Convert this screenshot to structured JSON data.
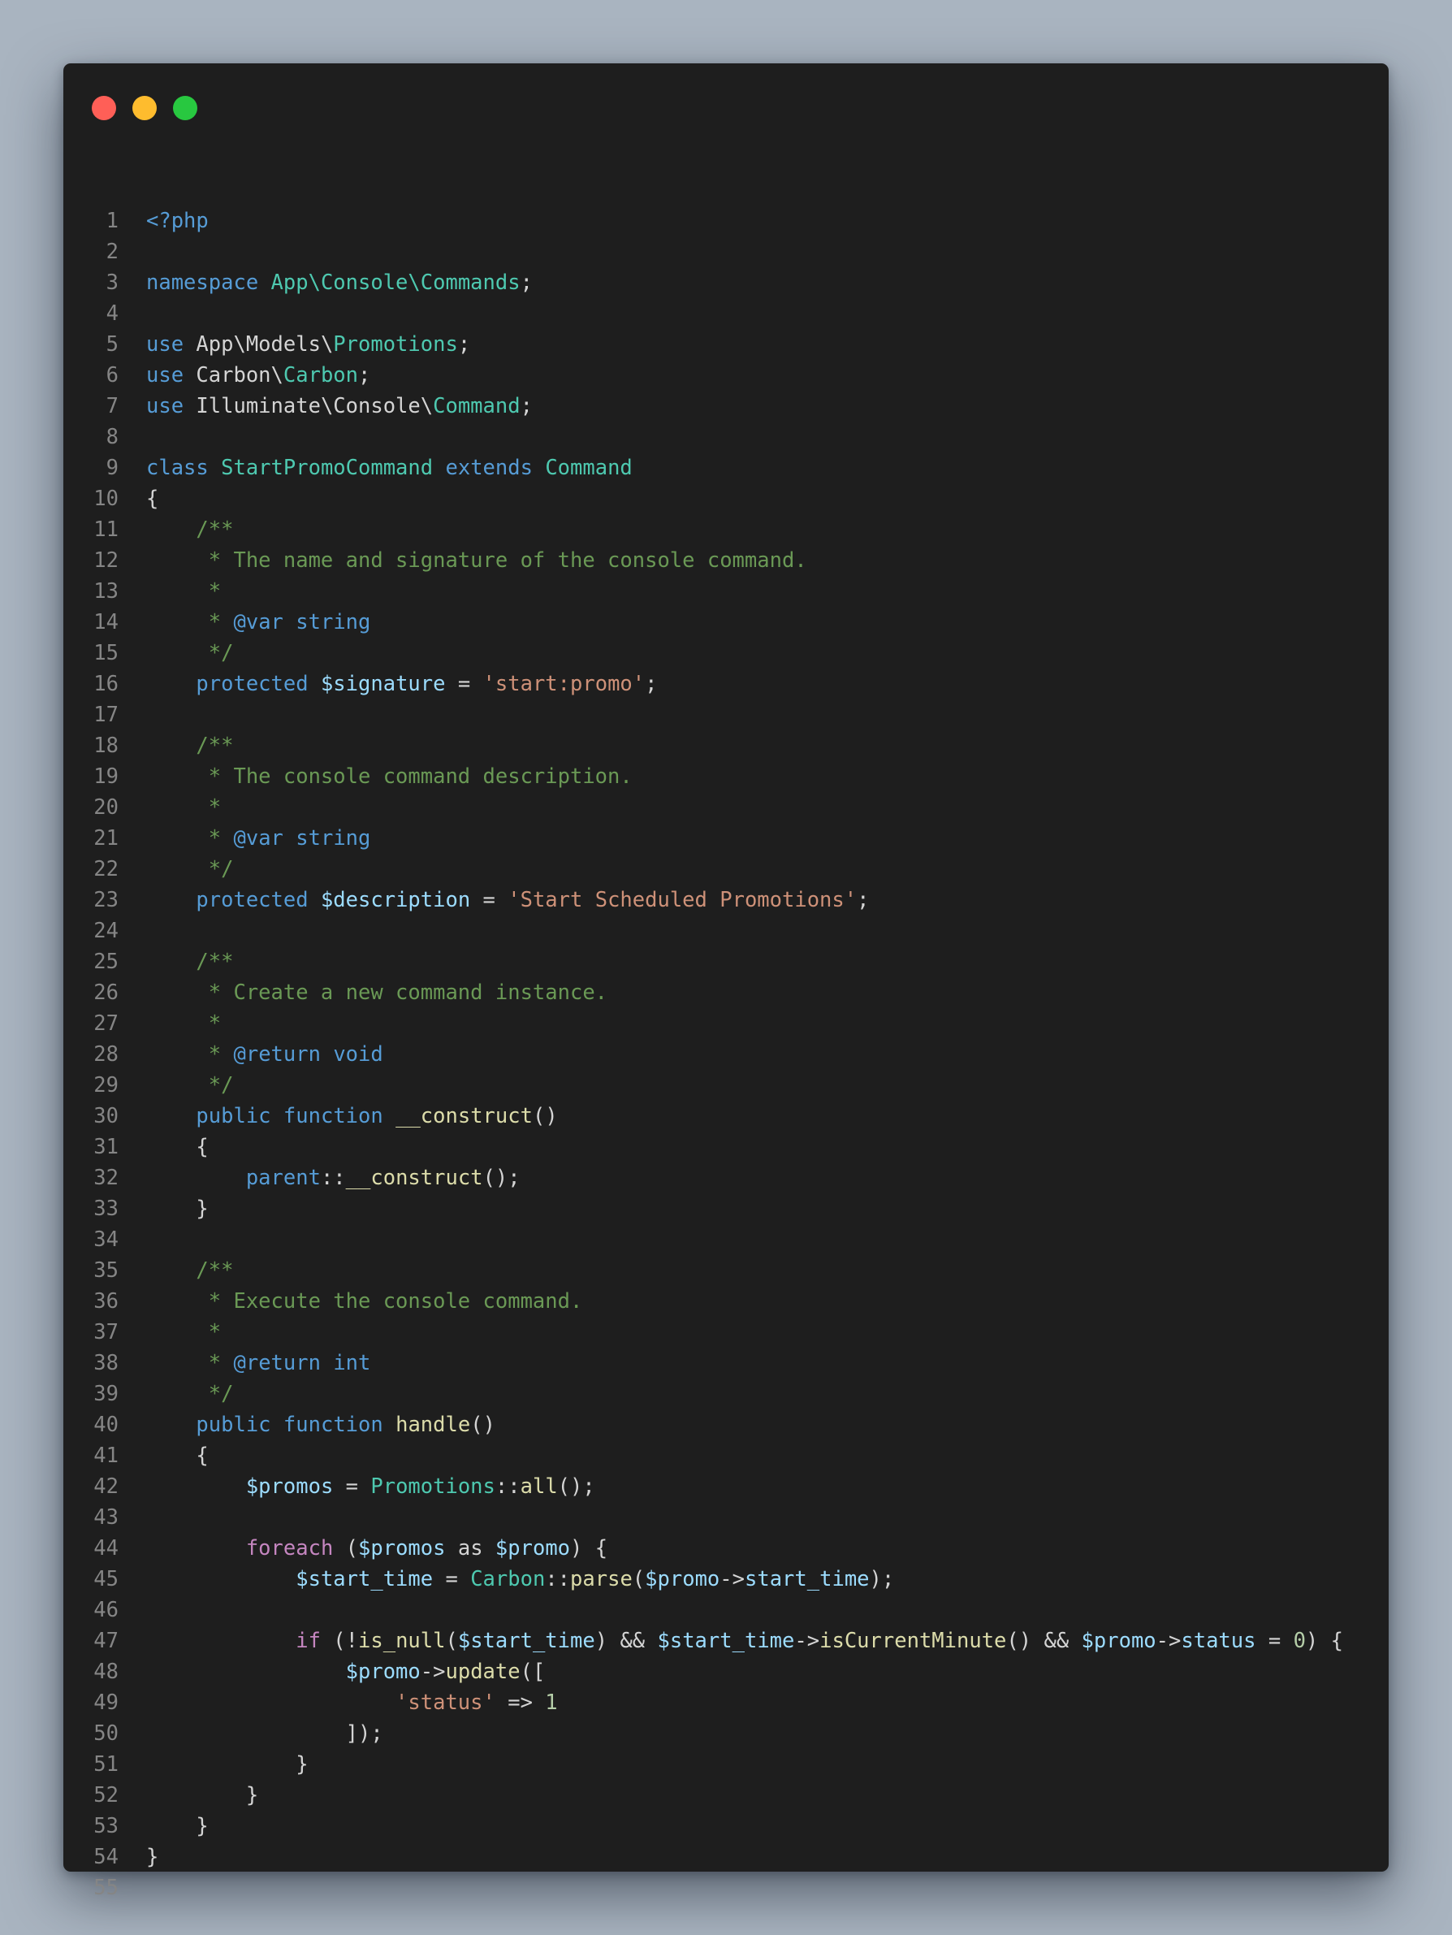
{
  "window": {
    "controls": [
      "close",
      "minimize",
      "maximize"
    ]
  },
  "code": {
    "language": "php",
    "lines": [
      [
        [
          "tag",
          "<?php"
        ]
      ],
      [],
      [
        [
          "kw",
          "namespace"
        ],
        [
          "plain",
          " "
        ],
        [
          "cls",
          "App\\Console\\Commands"
        ],
        [
          "plain",
          ";"
        ]
      ],
      [],
      [
        [
          "kw",
          "use"
        ],
        [
          "plain",
          " App\\Models\\"
        ],
        [
          "cls",
          "Promotions"
        ],
        [
          "plain",
          ";"
        ]
      ],
      [
        [
          "kw",
          "use"
        ],
        [
          "plain",
          " Carbon\\"
        ],
        [
          "cls",
          "Carbon"
        ],
        [
          "plain",
          ";"
        ]
      ],
      [
        [
          "kw",
          "use"
        ],
        [
          "plain",
          " Illuminate\\Console\\"
        ],
        [
          "cls",
          "Command"
        ],
        [
          "plain",
          ";"
        ]
      ],
      [],
      [
        [
          "kw",
          "class"
        ],
        [
          "plain",
          " "
        ],
        [
          "cls",
          "StartPromoCommand"
        ],
        [
          "plain",
          " "
        ],
        [
          "kw",
          "extends"
        ],
        [
          "plain",
          " "
        ],
        [
          "cls",
          "Command"
        ]
      ],
      [
        [
          "plain",
          "{"
        ]
      ],
      [
        [
          "plain",
          "    "
        ],
        [
          "cmt",
          "/**"
        ]
      ],
      [
        [
          "plain",
          "     "
        ],
        [
          "cmt",
          "* The name and signature of the console command."
        ]
      ],
      [
        [
          "plain",
          "     "
        ],
        [
          "cmt",
          "*"
        ]
      ],
      [
        [
          "plain",
          "     "
        ],
        [
          "cmt",
          "* "
        ],
        [
          "kw",
          "@var"
        ],
        [
          "plain",
          " "
        ],
        [
          "kw",
          "string"
        ]
      ],
      [
        [
          "plain",
          "     "
        ],
        [
          "cmt",
          "*/"
        ]
      ],
      [
        [
          "plain",
          "    "
        ],
        [
          "kw",
          "protected"
        ],
        [
          "plain",
          " "
        ],
        [
          "var",
          "$signature"
        ],
        [
          "plain",
          " = "
        ],
        [
          "str",
          "'start:promo'"
        ],
        [
          "plain",
          ";"
        ]
      ],
      [],
      [
        [
          "plain",
          "    "
        ],
        [
          "cmt",
          "/**"
        ]
      ],
      [
        [
          "plain",
          "     "
        ],
        [
          "cmt",
          "* The console command description."
        ]
      ],
      [
        [
          "plain",
          "     "
        ],
        [
          "cmt",
          "*"
        ]
      ],
      [
        [
          "plain",
          "     "
        ],
        [
          "cmt",
          "* "
        ],
        [
          "kw",
          "@var"
        ],
        [
          "plain",
          " "
        ],
        [
          "kw",
          "string"
        ]
      ],
      [
        [
          "plain",
          "     "
        ],
        [
          "cmt",
          "*/"
        ]
      ],
      [
        [
          "plain",
          "    "
        ],
        [
          "kw",
          "protected"
        ],
        [
          "plain",
          " "
        ],
        [
          "var",
          "$description"
        ],
        [
          "plain",
          " = "
        ],
        [
          "str",
          "'Start Scheduled Promotions'"
        ],
        [
          "plain",
          ";"
        ]
      ],
      [],
      [
        [
          "plain",
          "    "
        ],
        [
          "cmt",
          "/**"
        ]
      ],
      [
        [
          "plain",
          "     "
        ],
        [
          "cmt",
          "* Create a new command instance."
        ]
      ],
      [
        [
          "plain",
          "     "
        ],
        [
          "cmt",
          "*"
        ]
      ],
      [
        [
          "plain",
          "     "
        ],
        [
          "cmt",
          "* "
        ],
        [
          "kw",
          "@return"
        ],
        [
          "plain",
          " "
        ],
        [
          "kw",
          "void"
        ]
      ],
      [
        [
          "plain",
          "     "
        ],
        [
          "cmt",
          "*/"
        ]
      ],
      [
        [
          "plain",
          "    "
        ],
        [
          "kw",
          "public"
        ],
        [
          "plain",
          " "
        ],
        [
          "kw",
          "function"
        ],
        [
          "plain",
          " "
        ],
        [
          "fn",
          "__construct"
        ],
        [
          "plain",
          "()"
        ]
      ],
      [
        [
          "plain",
          "    {"
        ]
      ],
      [
        [
          "plain",
          "        "
        ],
        [
          "kw",
          "parent"
        ],
        [
          "plain",
          "::"
        ],
        [
          "fn",
          "__construct"
        ],
        [
          "plain",
          "();"
        ]
      ],
      [
        [
          "plain",
          "    }"
        ]
      ],
      [],
      [
        [
          "plain",
          "    "
        ],
        [
          "cmt",
          "/**"
        ]
      ],
      [
        [
          "plain",
          "     "
        ],
        [
          "cmt",
          "* Execute the console command."
        ]
      ],
      [
        [
          "plain",
          "     "
        ],
        [
          "cmt",
          "*"
        ]
      ],
      [
        [
          "plain",
          "     "
        ],
        [
          "cmt",
          "* "
        ],
        [
          "kw",
          "@return"
        ],
        [
          "plain",
          " "
        ],
        [
          "kw",
          "int"
        ]
      ],
      [
        [
          "plain",
          "     "
        ],
        [
          "cmt",
          "*/"
        ]
      ],
      [
        [
          "plain",
          "    "
        ],
        [
          "kw",
          "public"
        ],
        [
          "plain",
          " "
        ],
        [
          "kw",
          "function"
        ],
        [
          "plain",
          " "
        ],
        [
          "fn",
          "handle"
        ],
        [
          "plain",
          "()"
        ]
      ],
      [
        [
          "plain",
          "    {"
        ]
      ],
      [
        [
          "plain",
          "        "
        ],
        [
          "var",
          "$promos"
        ],
        [
          "plain",
          " = "
        ],
        [
          "cls",
          "Promotions"
        ],
        [
          "plain",
          "::"
        ],
        [
          "fn",
          "all"
        ],
        [
          "plain",
          "();"
        ]
      ],
      [],
      [
        [
          "plain",
          "        "
        ],
        [
          "ctl",
          "foreach"
        ],
        [
          "plain",
          " ("
        ],
        [
          "var",
          "$promos"
        ],
        [
          "plain",
          " as "
        ],
        [
          "var",
          "$promo"
        ],
        [
          "plain",
          ") {"
        ]
      ],
      [
        [
          "plain",
          "            "
        ],
        [
          "var",
          "$start_time"
        ],
        [
          "plain",
          " = "
        ],
        [
          "cls",
          "Carbon"
        ],
        [
          "plain",
          "::"
        ],
        [
          "fn",
          "parse"
        ],
        [
          "plain",
          "("
        ],
        [
          "var",
          "$promo"
        ],
        [
          "plain",
          "->"
        ],
        [
          "var",
          "start_time"
        ],
        [
          "plain",
          ");"
        ]
      ],
      [],
      [
        [
          "plain",
          "            "
        ],
        [
          "ctl",
          "if"
        ],
        [
          "plain",
          " (!"
        ],
        [
          "fn",
          "is_null"
        ],
        [
          "plain",
          "("
        ],
        [
          "var",
          "$start_time"
        ],
        [
          "plain",
          ") && "
        ],
        [
          "var",
          "$start_time"
        ],
        [
          "plain",
          "->"
        ],
        [
          "fn",
          "isCurrentMinute"
        ],
        [
          "plain",
          "() && "
        ],
        [
          "var",
          "$promo"
        ],
        [
          "plain",
          "->"
        ],
        [
          "var",
          "status"
        ],
        [
          "plain",
          " = "
        ],
        [
          "num",
          "0"
        ],
        [
          "plain",
          ") {"
        ]
      ],
      [
        [
          "plain",
          "                "
        ],
        [
          "var",
          "$promo"
        ],
        [
          "plain",
          "->"
        ],
        [
          "fn",
          "update"
        ],
        [
          "plain",
          "(["
        ]
      ],
      [
        [
          "plain",
          "                    "
        ],
        [
          "str",
          "'status'"
        ],
        [
          "plain",
          " => "
        ],
        [
          "num",
          "1"
        ]
      ],
      [
        [
          "plain",
          "                ]);"
        ]
      ],
      [
        [
          "plain",
          "            }"
        ]
      ],
      [
        [
          "plain",
          "        }"
        ]
      ],
      [
        [
          "plain",
          "    }"
        ]
      ],
      [
        [
          "plain",
          "}"
        ]
      ],
      []
    ]
  }
}
